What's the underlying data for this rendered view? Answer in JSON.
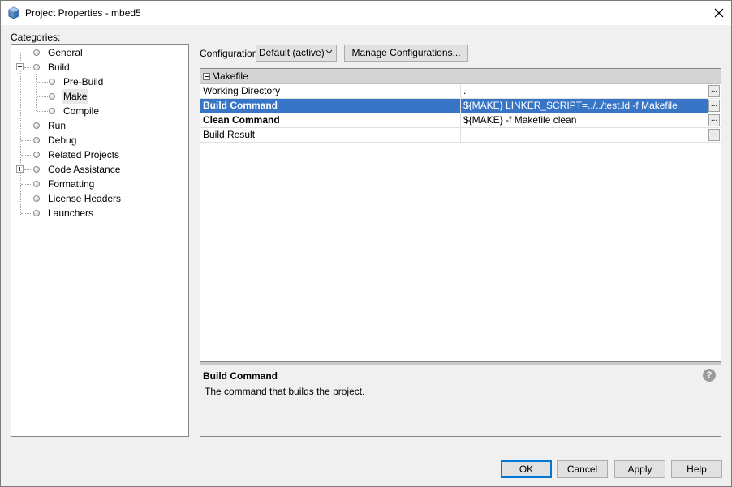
{
  "window": {
    "title": "Project Properties - mbed5",
    "close_glyph": "✕"
  },
  "categories": {
    "label": "Categories:",
    "items": [
      {
        "label": "General",
        "level": 0
      },
      {
        "label": "Build",
        "level": 0,
        "expanded": true
      },
      {
        "label": "Pre-Build",
        "level": 1
      },
      {
        "label": "Make",
        "level": 1,
        "selected": true
      },
      {
        "label": "Compile",
        "level": 1
      },
      {
        "label": "Run",
        "level": 0
      },
      {
        "label": "Debug",
        "level": 0
      },
      {
        "label": "Related Projects",
        "level": 0
      },
      {
        "label": "Code Assistance",
        "level": 0,
        "expanded": false
      },
      {
        "label": "Formatting",
        "level": 0
      },
      {
        "label": "License Headers",
        "level": 0
      },
      {
        "label": "Launchers",
        "level": 0
      }
    ]
  },
  "configuration": {
    "label": "Configuration:",
    "selected": "Default (active)",
    "manage_button": "Manage Configurations..."
  },
  "sheet": {
    "group": "Makefile",
    "rows": [
      {
        "name": "Working Directory",
        "value": ".",
        "bold": false,
        "selected": false
      },
      {
        "name": "Build Command",
        "value": "${MAKE} LINKER_SCRIPT=../../test.ld -f Makefile",
        "bold": true,
        "selected": true
      },
      {
        "name": "Clean Command",
        "value": "${MAKE} -f Makefile clean",
        "bold": true,
        "selected": false
      },
      {
        "name": "Build Result",
        "value": "",
        "bold": false,
        "selected": false
      }
    ],
    "ellipsis": "..."
  },
  "description": {
    "title": "Build Command",
    "text": "The command that builds the project.",
    "help_glyph": "?"
  },
  "buttons": {
    "ok": "OK",
    "cancel": "Cancel",
    "apply": "Apply",
    "help": "Help"
  },
  "colors": {
    "selection": "#3875c6",
    "default_button_border": "#0078d7"
  }
}
